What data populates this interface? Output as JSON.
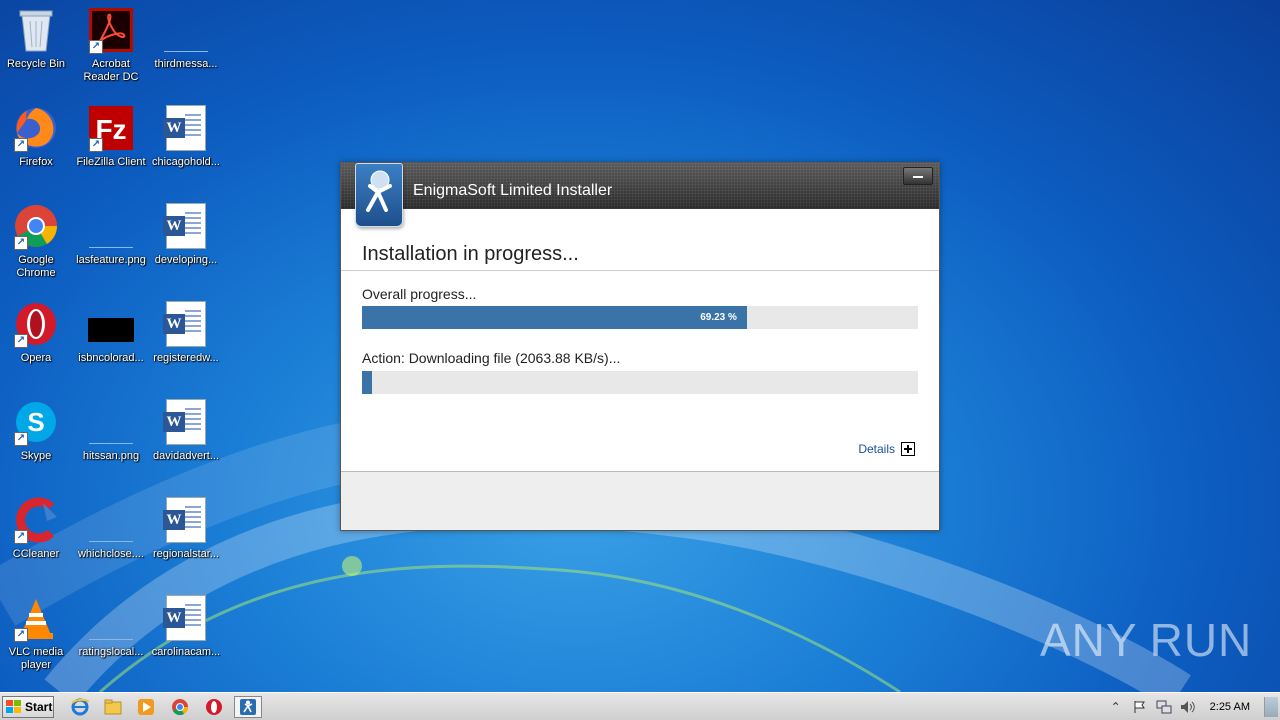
{
  "desktop": {
    "icons": [
      {
        "label": "Recycle Bin"
      },
      {
        "label": "Acrobat Reader DC"
      },
      {
        "label": "thirdmessa..."
      },
      {
        "label": "Firefox"
      },
      {
        "label": "FileZilla Client"
      },
      {
        "label": "chicagohold..."
      },
      {
        "label": "Google Chrome"
      },
      {
        "label": "lasfeature.png"
      },
      {
        "label": "developing..."
      },
      {
        "label": "Opera"
      },
      {
        "label": "isbncolorad..."
      },
      {
        "label": "registeredw..."
      },
      {
        "label": "Skype"
      },
      {
        "label": "hitssan.png"
      },
      {
        "label": "davidadvert..."
      },
      {
        "label": "CCleaner"
      },
      {
        "label": "whichclose...."
      },
      {
        "label": "regionalstar..."
      },
      {
        "label": "VLC media player"
      },
      {
        "label": "ratingslocal..."
      },
      {
        "label": "carolinacam..."
      }
    ]
  },
  "installer": {
    "title": "EnigmaSoft Limited Installer",
    "heading": "Installation in progress...",
    "overall_label": "Overall progress...",
    "overall_percent_text": "69.23 %",
    "overall_fraction": 0.6923,
    "action_label": "Action: Downloading file (2063.88 KB/s)...",
    "action_fraction": 0.005,
    "details_label": "Details",
    "accent_color": "#3a73a8"
  },
  "watermark": {
    "text_left": "ANY",
    "text_right": "RUN"
  },
  "taskbar": {
    "start_label": "Start",
    "pinned": [
      "internet-explorer-icon",
      "explorer-icon",
      "media-player-icon",
      "chrome-icon",
      "opera-icon",
      "enigmasoft-icon"
    ],
    "clock": "2:25 AM"
  }
}
